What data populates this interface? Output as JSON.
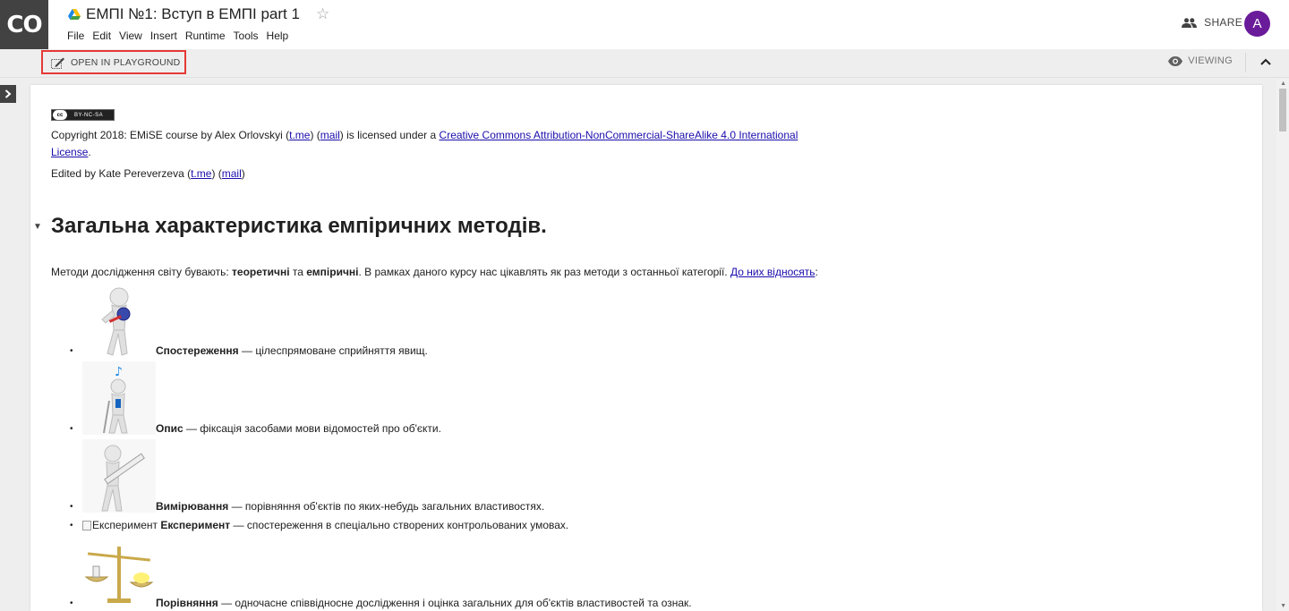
{
  "app": {
    "logo_text": "CO"
  },
  "document": {
    "title": "ЕМПІ №1: Вступ в ЕМПІ part 1"
  },
  "menu": [
    "File",
    "Edit",
    "View",
    "Insert",
    "Runtime",
    "Tools",
    "Help"
  ],
  "header": {
    "share_label": "SHARE",
    "avatar_initial": "A"
  },
  "toolbar": {
    "playground_label": "OPEN IN PLAYGROUND",
    "viewing_label": "VIEWING"
  },
  "license": {
    "badge_text": "BY-NC-SA",
    "badge_cc": "cc",
    "copyright_pre": "Copyright 2018: EMiSE course by Alex Orlovskyi (",
    "tme_link": "t.me",
    "mid1": ") (",
    "mail_link": "mail",
    "mid2": ") is licensed under a ",
    "license_link_line1": "Creative Commons Attribution-NonCommercial-ShareAlike 4.0 International",
    "license_link_line2": "License",
    "end": "."
  },
  "edited": {
    "pre": "Edited by Kate Pereverzeva (",
    "tme_link": "t.me",
    "mid": ") (",
    "mail_link": "mail",
    "end": ")"
  },
  "section": {
    "heading": "Загальна характеристика емпіричних методів.",
    "intro_pre": "Методи дослідження світу бувають: ",
    "intro_b1": "теоретичні",
    "intro_mid1": " та ",
    "intro_b2": "емпіричні",
    "intro_mid2": ". В рамках даного курсу нас цікавлять як раз методи з останньої категорії. ",
    "intro_link": "До них відносять",
    "intro_end": ":"
  },
  "methods": [
    {
      "term": "Спостереження",
      "desc": " — цілеспрямоване сприйняття явищ."
    },
    {
      "term": "Опис",
      "desc": " — фіксація засобами мови відомостей про об'єкти."
    },
    {
      "term": "Вимірювання",
      "desc": " — порівняння об'єктів по яких-небудь загальних властивостях."
    },
    {
      "term": "Експеримент",
      "desc": " — спостереження в спеціально створених контрольованих умовах.",
      "img_alt": "Експеримент"
    },
    {
      "term": "Порівняння",
      "desc": " — одночасне співвідносне дослідження і оцінка загальних для об'єктів властивостей та ознак."
    }
  ]
}
